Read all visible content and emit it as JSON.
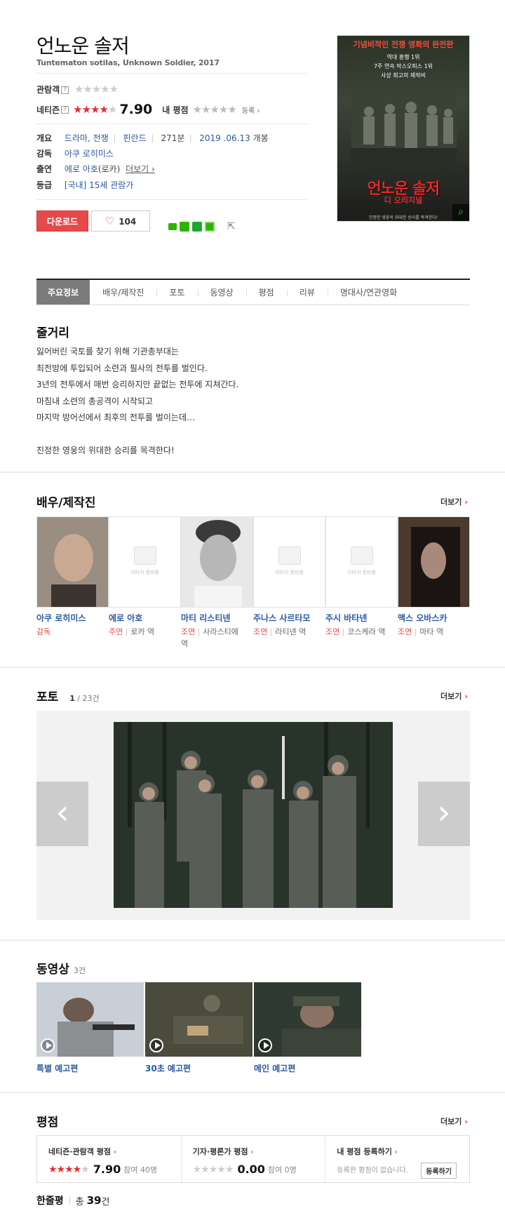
{
  "movie": {
    "title": "언노운 솔저",
    "subtitle": "Tuntematon sotilas, Unknown Soldier, 2017",
    "audience_label": "관람객",
    "netizen_label": "네티즌",
    "netizen_score": "7.90",
    "my_rating_label": "내 평점",
    "register_label": "등록",
    "info": {
      "overview_label": "개요",
      "genre": "드라마, 전쟁",
      "country": "핀란드",
      "runtime": "271분",
      "release": "2019 .06.13",
      "release_suffix": "개봉",
      "director_label": "감독",
      "director": "아쿠 로히미스",
      "cast_label": "출연",
      "cast_main": "에로 아호",
      "cast_role": "(로카)",
      "cast_more": "더보기",
      "grade_label": "등급",
      "grade": "[국내] 15세 관람가"
    },
    "download_label": "다운로드",
    "like_count": "104"
  },
  "poster": {
    "top_text": "기념비적인 전쟁 영화의 완전판",
    "line1": "역대 흥행 1위",
    "line2": "7주 연속 박스오피스 1위",
    "line3": "사상 최고의 제작비",
    "title": "언노운 솔저",
    "sub": "디 오리지널",
    "bottom": "진정한 영웅의 위대한 승리를 목격한다!"
  },
  "tabs": [
    "주요정보",
    "배우/제작진",
    "포토",
    "동영상",
    "평점",
    "리뷰",
    "명대사/연관영화"
  ],
  "synopsis": {
    "title": "줄거리",
    "lines": [
      "잃어버린 국토를 찾기 위해 기관총부대는",
      " 최전방에 투입되어 소련과 필사의 전투를 벌인다.",
      " 3년의 전투에서 매번 승리하지만 끝없는 전투에 지쳐간다.",
      " 마침내 소련의 총공격이 시작되고",
      " 마지막 방어선에서 최후의 전투를 벌이는데…",
      "",
      " 진정한 영웅의 위대한 승리를 목격한다!"
    ]
  },
  "cast_section": {
    "title": "배우/제작진",
    "more": "더보기",
    "no_image": "이미지 준비중",
    "people": [
      {
        "name": "아쿠 로히미스",
        "type": "감독",
        "role": ""
      },
      {
        "name": "에로 아호",
        "type": "주연",
        "role": "로카 역"
      },
      {
        "name": "마티 리스티넨",
        "type": "조연",
        "role": "사라스티에",
        "role2": "역"
      },
      {
        "name": "주나스 사르타모",
        "type": "조연",
        "role": "라티넨 역"
      },
      {
        "name": "주시 바타넨",
        "type": "조연",
        "role": "코스케라 역"
      },
      {
        "name": "맥스 오바스카",
        "type": "조연",
        "role": "마타 역"
      }
    ]
  },
  "photo_section": {
    "title": "포토",
    "current": "1",
    "total": "/ 23건",
    "more": "더보기"
  },
  "video_section": {
    "title": "동영상",
    "count": "3건",
    "videos": [
      "특별 예고편",
      "30초 예고편",
      "메인 예고편"
    ]
  },
  "rating_section": {
    "title": "평점",
    "more": "더보기",
    "netizen_title": "네티즌·관람객 평점",
    "netizen_score": "7.90",
    "netizen_count": "참여 40명",
    "critic_title": "기자·평론가 평점",
    "critic_score": "0.00",
    "critic_count": "참여 0명",
    "my_title": "내 평점 등록하기",
    "my_text": "등록한 평점이 없습니다.",
    "my_button": "등록하기"
  },
  "oneline": {
    "title": "한줄평",
    "prefix": "총",
    "count": "39",
    "suffix": "건"
  },
  "colors": {
    "accent": "#e54a4a",
    "link": "#2c5aa0"
  }
}
